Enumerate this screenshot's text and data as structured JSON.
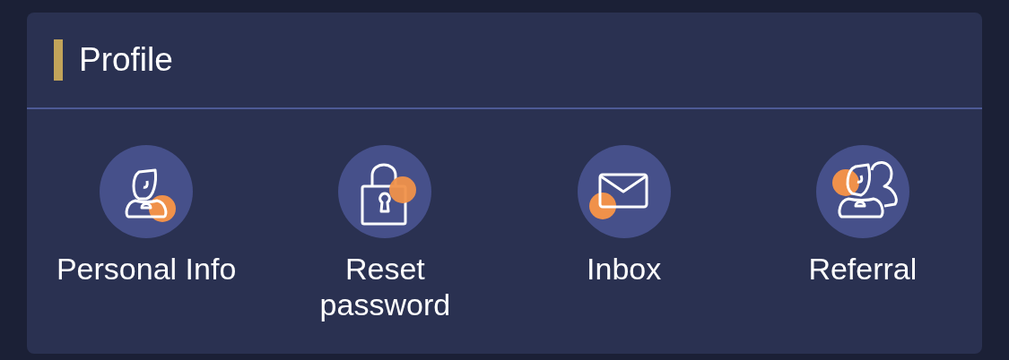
{
  "section": {
    "title": "Profile"
  },
  "items": [
    {
      "kind": "person",
      "label": "Personal Info"
    },
    {
      "kind": "lock",
      "label": "Reset\npassword"
    },
    {
      "kind": "mail",
      "label": "Inbox"
    },
    {
      "kind": "people",
      "label": "Referral"
    }
  ]
}
